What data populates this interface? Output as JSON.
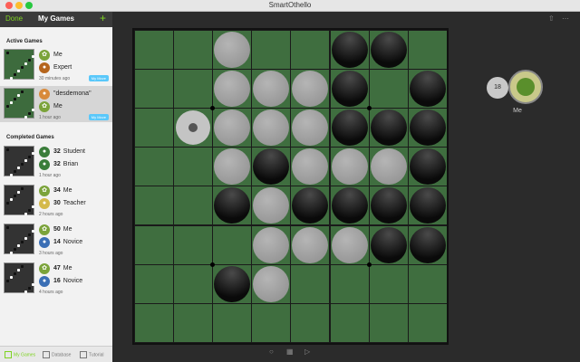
{
  "window": {
    "title": "SmartOthello"
  },
  "sidebar": {
    "done_label": "Done",
    "title": "My Games",
    "add_label": "+",
    "active_title": "Active Games",
    "completed_title": "Completed Games",
    "active_games": [
      {
        "p1": "Me",
        "p2": "Expert",
        "time": "30 minutes ago",
        "badge": "My Move"
      },
      {
        "p1": "\"desdemona\"",
        "p2": "Me",
        "time": "1 hour ago",
        "badge": "My Move"
      }
    ],
    "completed_games": [
      {
        "s1": "32",
        "p1": "Student",
        "s2": "32",
        "p2": "Brian",
        "time": "1 hour ago"
      },
      {
        "s1": "34",
        "p1": "Me",
        "s2": "30",
        "p2": "Teacher",
        "time": "2 hours ago"
      },
      {
        "s1": "50",
        "p1": "Me",
        "s2": "14",
        "p2": "Novice",
        "time": "3 hours ago"
      },
      {
        "s1": "47",
        "p1": "Me",
        "s2": "16",
        "p2": "Novice",
        "time": "4 hours ago"
      }
    ],
    "tabs": [
      "My Games",
      "Database",
      "Tutorial"
    ]
  },
  "board": {
    "rows": [
      "..W..BB.",
      "..WWWB.B",
      ".HWWWBBB",
      "..WBWWWB",
      "..BWBBBB",
      "...WWWBB",
      "..BW....",
      "........"
    ]
  },
  "player": {
    "count": "18",
    "name": "Me"
  },
  "colors": {
    "board": "#3f6e3f",
    "accent": "#7ed321",
    "badge": "#5ac8fa"
  }
}
